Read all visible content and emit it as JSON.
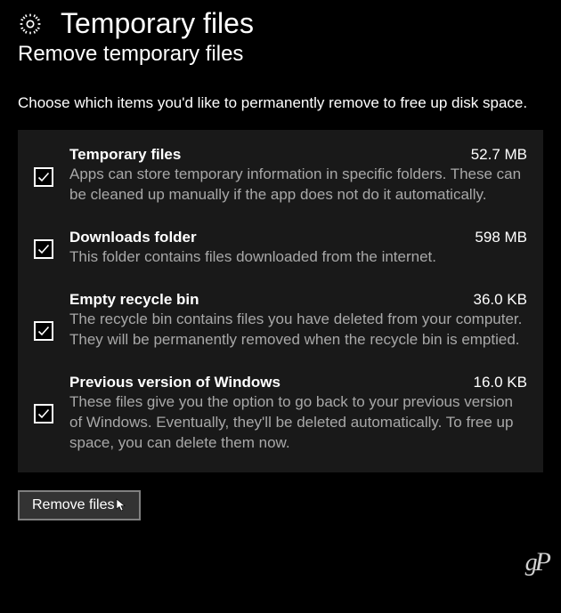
{
  "header": {
    "title": "Temporary files",
    "subtitle": "Remove temporary files",
    "instruction": "Choose which items you'd like to permanently remove to free up disk space."
  },
  "items": [
    {
      "title": "Temporary files",
      "size": "52.7 MB",
      "desc": "Apps can store temporary information in specific folders. These can be cleaned up manually if the app does not do it automatically.",
      "checked": true
    },
    {
      "title": "Downloads folder",
      "size": "598 MB",
      "desc": "This folder contains files downloaded from the internet.",
      "checked": true
    },
    {
      "title": "Empty recycle bin",
      "size": "36.0 KB",
      "desc": "The recycle bin contains files you have deleted from your computer. They will be permanently removed when the recycle bin is emptied.",
      "checked": true
    },
    {
      "title": "Previous version of Windows",
      "size": "16.0 KB",
      "desc": "These files give you the option to go back to your previous version of Windows. Eventually, they'll be deleted automatically. To free up space, you can delete them now.",
      "checked": true
    }
  ],
  "buttons": {
    "remove": "Remove files"
  },
  "watermark": "gP"
}
